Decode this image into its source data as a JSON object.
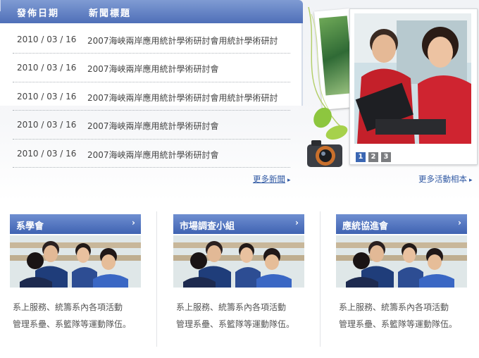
{
  "news": {
    "header_date": "發佈日期",
    "header_title": "新聞標題",
    "items": [
      {
        "date": "2010 / 03 / 16",
        "title": "2007海峽兩岸應用統計學術研討會用統計學術研討"
      },
      {
        "date": "2010 / 03 / 16",
        "title": "2007海峽兩岸應用統計學術研討會"
      },
      {
        "date": "2010 / 03 / 16",
        "title": "2007海峽兩岸應用統計學術研討會用統計學術研討"
      },
      {
        "date": "2010 / 03 / 16",
        "title": "2007海峽兩岸應用統計學術研討會"
      },
      {
        "date": "2010 / 03 / 16",
        "title": "2007海峽兩岸應用統計學術研討會"
      }
    ],
    "more_label": "更多新聞"
  },
  "album": {
    "pages": [
      "1",
      "2",
      "3"
    ],
    "current_page": "1",
    "more_label": "更多活動相本"
  },
  "cards": [
    {
      "title": "系學會",
      "desc_line1": "系上服務、統籌系內各項活動",
      "desc_line2": "管理系壘、系籃隊等運動隊伍。"
    },
    {
      "title": "市場調查小組",
      "desc_line1": "系上服務、統籌系內各項活動",
      "desc_line2": "管理系壘、系籃隊等運動隊伍。"
    },
    {
      "title": "應統協進會",
      "desc_line1": "系上服務、統籌系內各項活動",
      "desc_line2": "管理系壘、系籃隊等運動隊伍。"
    }
  ],
  "colors": {
    "accent_blue": "#4f6fb8",
    "link": "#2f58a3",
    "pager_active": "#3b67b3"
  }
}
